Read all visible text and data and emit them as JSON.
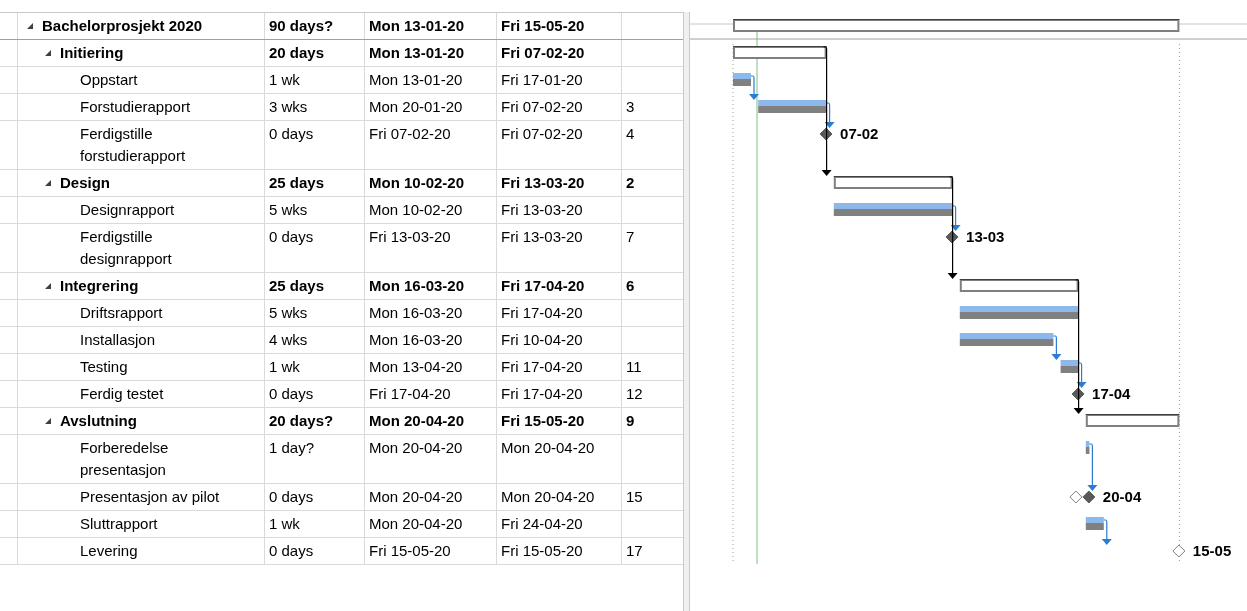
{
  "project": {
    "kind": "summary",
    "name": "Bachelorprosjekt 2020",
    "expanded": true,
    "duration": "90 days?",
    "start": "Mon 13-01-20",
    "finish": "Fri 15-05-20",
    "children": [
      {
        "kind": "summary",
        "name": "Initiering",
        "expanded": true,
        "duration": "20 days",
        "start": "Mon 13-01-20",
        "finish": "Fri 07-02-20",
        "children": [
          {
            "kind": "task",
            "name": "Oppstart",
            "duration": "1 wk",
            "start": "Mon 13-01-20",
            "finish": "Fri 17-01-20"
          },
          {
            "kind": "task",
            "name": "Forstudierapport",
            "duration": "3 wks",
            "start": "Mon 20-01-20",
            "finish": "Fri 07-02-20",
            "predecessors": "3"
          },
          {
            "kind": "milestone",
            "name": "Ferdigstille forstudierapport",
            "duration": "0 days",
            "start": "Fri 07-02-20",
            "finish": "Fri 07-02-20",
            "predecessors": "4",
            "label": "07-02",
            "filled": true
          }
        ]
      },
      {
        "kind": "summary",
        "name": "Design",
        "expanded": true,
        "duration": "25 days",
        "start": "Mon 10-02-20",
        "finish": "Fri 13-03-20",
        "predecessors": "2",
        "children": [
          {
            "kind": "task",
            "name": "Designrapport",
            "duration": "5 wks",
            "start": "Mon 10-02-20",
            "finish": "Fri 13-03-20"
          },
          {
            "kind": "milestone",
            "name": "Ferdigstille designrapport",
            "duration": "0 days",
            "start": "Fri 13-03-20",
            "finish": "Fri 13-03-20",
            "predecessors": "7",
            "label": "13-03",
            "filled": true
          }
        ]
      },
      {
        "kind": "summary",
        "name": "Integrering",
        "expanded": true,
        "duration": "25 days",
        "start": "Mon 16-03-20",
        "finish": "Fri 17-04-20",
        "predecessors": "6",
        "children": [
          {
            "kind": "task",
            "name": "Driftsrapport",
            "duration": "5 wks",
            "start": "Mon 16-03-20",
            "finish": "Fri 17-04-20"
          },
          {
            "kind": "task",
            "name": "Installasjon",
            "duration": "4 wks",
            "start": "Mon 16-03-20",
            "finish": "Fri 10-04-20"
          },
          {
            "kind": "task",
            "name": "Testing",
            "duration": "1 wk",
            "start": "Mon 13-04-20",
            "finish": "Fri 17-04-20",
            "predecessors": "11"
          },
          {
            "kind": "milestone",
            "name": "Ferdig testet",
            "duration": "0 days",
            "start": "Fri 17-04-20",
            "finish": "Fri 17-04-20",
            "predecessors": "12",
            "label": "17-04",
            "filled": true
          }
        ]
      },
      {
        "kind": "summary",
        "name": "Avslutning",
        "expanded": true,
        "duration": "20 days?",
        "start": "Mon 20-04-20",
        "finish": "Fri 15-05-20",
        "predecessors": "9",
        "children": [
          {
            "kind": "task",
            "name": "Forberedelse presentasjon",
            "duration": "1 day?",
            "start": "Mon 20-04-20",
            "finish": "Mon 20-04-20"
          },
          {
            "kind": "milestone",
            "name": "Presentasjon av pilot",
            "duration": "0 days",
            "start": "Mon 20-04-20",
            "finish": "Mon 20-04-20",
            "predecessors": "15",
            "label": "20-04",
            "filled": true,
            "baseline": true
          },
          {
            "kind": "task",
            "name": "Sluttrapport",
            "duration": "1 wk",
            "start": "Mon 20-04-20",
            "finish": "Fri 24-04-20"
          },
          {
            "kind": "milestone",
            "name": "Levering",
            "duration": "0 days",
            "start": "Fri 15-05-20",
            "finish": "Fri 15-05-20",
            "predecessors": "17",
            "label": "15-05",
            "filled": false
          }
        ]
      }
    ]
  }
}
